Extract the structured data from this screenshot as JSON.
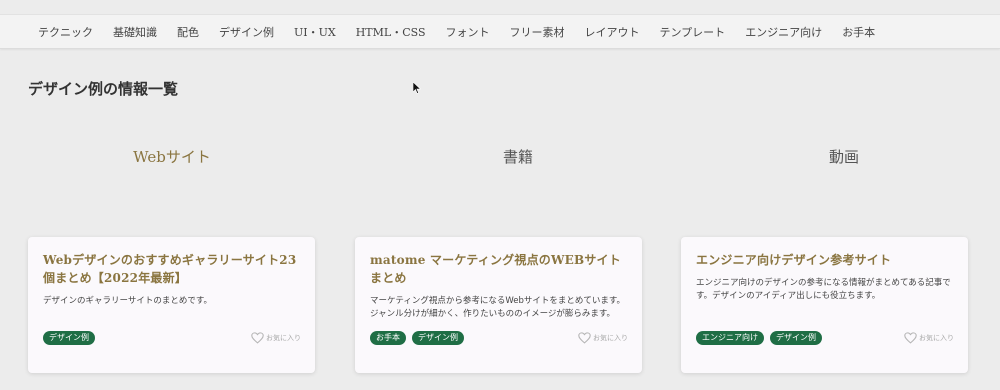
{
  "nav": {
    "items": [
      "テクニック",
      "基礎知識",
      "配色",
      "デザイン例",
      "UI・UX",
      "HTML・CSS",
      "フォント",
      "フリー素材",
      "レイアウト",
      "テンプレート",
      "エンジニア向け",
      "お手本"
    ]
  },
  "page": {
    "title": "デザイン例の情報一覧"
  },
  "tabs": [
    {
      "label": "Webサイト",
      "active": true
    },
    {
      "label": "書籍",
      "active": false
    },
    {
      "label": "動画",
      "active": false
    }
  ],
  "cards": [
    {
      "title": "Webデザインのおすすめギャラリーサイト23個まとめ【2022年最新】",
      "description": "デザインのギャラリーサイトのまとめです。",
      "tags": [
        "デザイン例"
      ],
      "favorite_label": "お気に入り"
    },
    {
      "title": "matome マーケティング視点のWEBサイトまとめ",
      "description": "マーケティング視点から参考になるWebサイトをまとめています。ジャンル分けが細かく、作りたいもののイメージが膨らみます。",
      "tags": [
        "お手本",
        "デザイン例"
      ],
      "favorite_label": "お気に入り"
    },
    {
      "title": "エンジニア向けデザイン参考サイト",
      "description": "エンジニア向けのデザインの参考になる情報がまとめてある記事です。デザインのアイディア出しにも役立ちます。",
      "tags": [
        "エンジニア向け",
        "デザイン例"
      ],
      "favorite_label": "お気に入り"
    }
  ],
  "colors": {
    "accent": "#8a7540",
    "tag_bg": "#1f6e45",
    "background": "#ececec"
  }
}
